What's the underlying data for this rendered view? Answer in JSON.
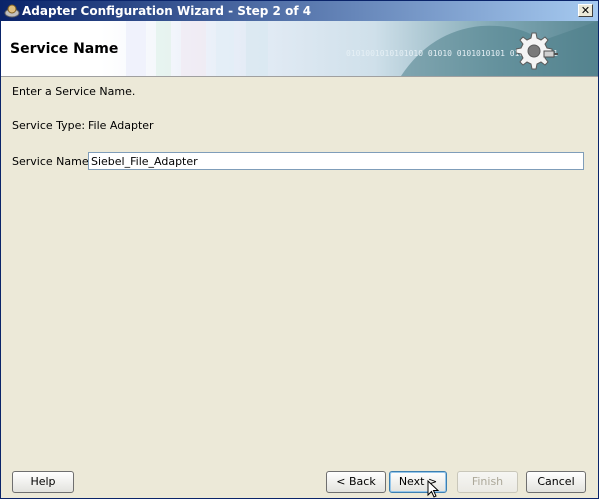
{
  "window": {
    "title": "Adapter Configuration Wizard - Step 2 of 4",
    "close_glyph": "✕"
  },
  "banner": {
    "title": "Service Name",
    "binary_text": "0101001010101010 01010 0101010101 01010 0101",
    "icon": "gear-plug-icon"
  },
  "form": {
    "instruction": "Enter a Service Name.",
    "service_type_label": "Service Type:",
    "service_type_value": "File Adapter",
    "service_name_label": "Service Name:",
    "service_name_value": "Siebel_File_Adapter"
  },
  "buttons": {
    "help": "Help",
    "back": "< Back",
    "next": "Next >",
    "finish": "Finish",
    "cancel": "Cancel"
  },
  "colors": {
    "titlebar_start": "#0a246a",
    "titlebar_end": "#a6caf0",
    "panel_bg": "#ece9d8"
  }
}
